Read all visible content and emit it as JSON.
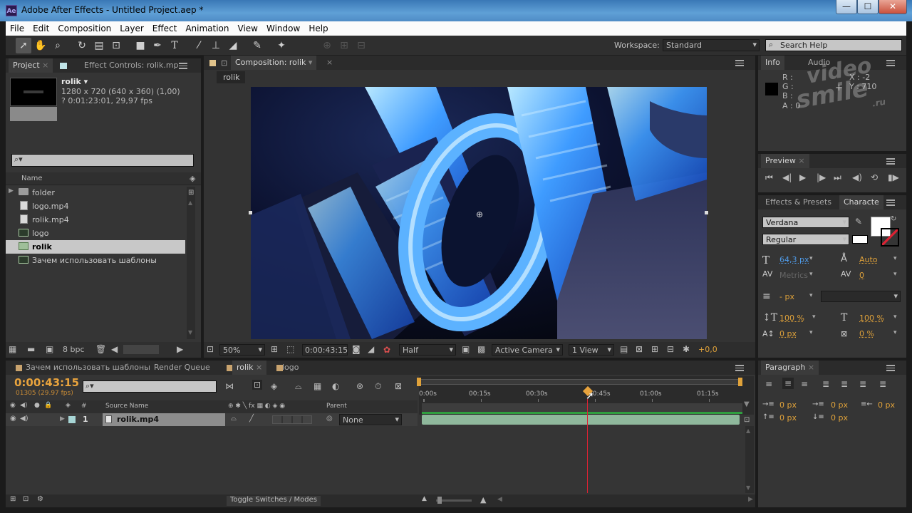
{
  "window": {
    "app_badge": "Ae",
    "title": "Adobe After Effects - Untitled Project.aep *",
    "minimize": "—",
    "maximize": "☐",
    "close": "✕"
  },
  "menu": [
    "File",
    "Edit",
    "Composition",
    "Layer",
    "Effect",
    "Animation",
    "View",
    "Window",
    "Help"
  ],
  "toolbar": {
    "workspace_label": "Workspace:",
    "workspace_value": "Standard",
    "search_placeholder": "Search Help"
  },
  "project_panel": {
    "tab_project": "Project",
    "tab_effect_controls": "Effect Controls: rolik.mp",
    "item_name": "rolik ▾",
    "item_info1": "1280 x 720  (640 x 360) (1,00)",
    "item_info2": "? 0:01:23:01, 29,97 fps",
    "col_name": "Name",
    "items": [
      {
        "name": "folder",
        "icon": "folder-icon"
      },
      {
        "name": "logo.mp4",
        "icon": "footage-icon"
      },
      {
        "name": "rolik.mp4",
        "icon": "footage-icon"
      },
      {
        "name": "logo",
        "icon": "composition-icon"
      },
      {
        "name": "rolik",
        "icon": "composition-icon"
      },
      {
        "name": "Зачем использовать шаблоны",
        "icon": "composition-icon"
      }
    ],
    "bpc": "8 bpc"
  },
  "comp_panel": {
    "tab": "Composition: rolik",
    "breadcrumb": "rolik",
    "zoom": "50%",
    "timecode": "0:00:43:15",
    "resolution": "Half",
    "camera": "Active Camera",
    "views": "1 View",
    "exposure": "+0,0"
  },
  "info_panel": {
    "tab_info": "Info",
    "tab_audio": "Audio",
    "r": "R :",
    "g": "G :",
    "b": "B :",
    "a": "A : 0",
    "x": "X : -2",
    "y": "Y : 710",
    "watermark_line1": "video",
    "watermark_line2": "smile",
    "watermark_line3": ".ru"
  },
  "preview_panel": {
    "tab": "Preview"
  },
  "character_panel": {
    "tab_effects": "Effects & Presets",
    "tab_character": "Characte",
    "font": "Verdana",
    "style": "Regular",
    "size": "64,3 px",
    "leading": "Auto",
    "kerning": "Metrics",
    "tracking": "0",
    "stroke_width": "- px",
    "vscale": "100 %",
    "hscale": "100 %",
    "baseline": "0 px",
    "tsume": "0 %"
  },
  "paragraph_panel": {
    "tab": "Paragraph",
    "indent_left": "0 px",
    "indent_first": "0 px",
    "indent_right": "0 px",
    "space_before": "0 px",
    "space_after": "0 px"
  },
  "timeline": {
    "tabs": [
      "Зачем использовать шаблоны",
      "Render Queue",
      "rolik",
      "logo"
    ],
    "timecode": "0:00:43:15",
    "frame_info": "01305 (29.97 fps)",
    "col_num": "#",
    "col_source": "Source Name",
    "col_parent": "Parent",
    "ruler": [
      "0:00s",
      "00:15s",
      "00:30s",
      "00:45s",
      "01:00s",
      "01:15s"
    ],
    "layer_num": "1",
    "layer_name": "rolik.mp4",
    "parent_value": "None",
    "toggle": "Toggle Switches / Modes"
  },
  "colors": {
    "accent": "#e0a23a",
    "timecode": "#e8a33d",
    "blue_value": "#4f9be8",
    "track_green": "#8fb89c"
  }
}
